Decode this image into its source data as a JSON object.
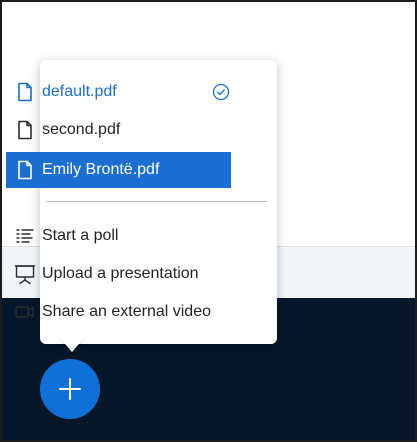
{
  "menu": {
    "presentations": [
      {
        "label": "default.pdf",
        "state": "current"
      },
      {
        "label": "second.pdf",
        "state": "normal"
      },
      {
        "label": "Emily Brontë.pdf",
        "state": "highlighted"
      }
    ],
    "actions": [
      {
        "label": "Start a poll",
        "icon": "list-icon"
      },
      {
        "label": "Upload a presentation",
        "icon": "presentation-board-icon"
      },
      {
        "label": "Share an external video",
        "icon": "video-camera-icon"
      }
    ]
  },
  "colors": {
    "accent": "#1b6fd2",
    "button": "#0f70d7",
    "action_bar": "#06172a",
    "text": "#1f2226"
  },
  "icons": {
    "file": "file-icon",
    "current_check": "check-circle-icon",
    "plus_button": "plus-icon"
  }
}
